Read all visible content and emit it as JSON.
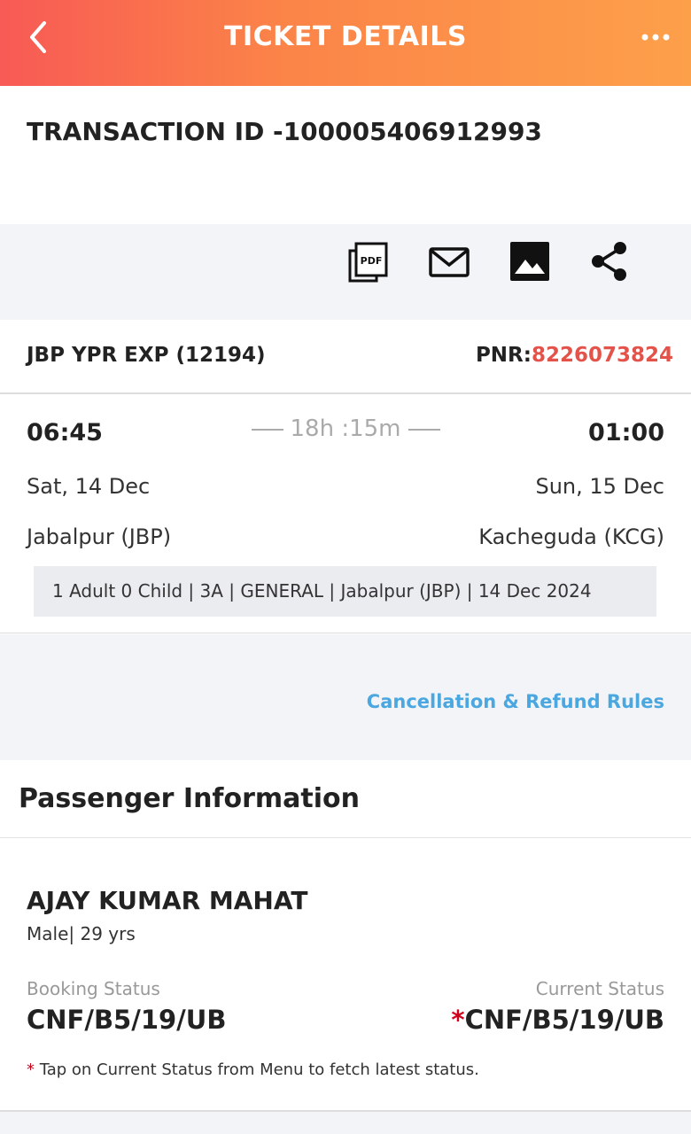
{
  "header": {
    "title": "TICKET DETAILS",
    "back_icon": "chevron-left-icon",
    "more_icon": "more-dots-icon"
  },
  "transaction": {
    "label": "TRANSACTION ID -100005406912993"
  },
  "actions": [
    {
      "icon": "pdf-icon"
    },
    {
      "icon": "mail-icon"
    },
    {
      "icon": "image-icon"
    },
    {
      "icon": "share-icon"
    }
  ],
  "train": {
    "name": "JBP YPR EXP  (12194)",
    "pnr_label": "PNR:",
    "pnr_value": "8226073824"
  },
  "journey": {
    "departure_time": "06:45",
    "arrival_time": "01:00",
    "duration": "18h :15m",
    "departure_date": "Sat, 14 Dec",
    "arrival_date": "Sun, 15 Dec",
    "departure_station": "Jabalpur (JBP)",
    "arrival_station": "Kacheguda (KCG)",
    "summary": "1 Adult 0 Child  | 3A | GENERAL | Jabalpur (JBP) | 14 Dec 2024"
  },
  "rules": {
    "link_label": "Cancellation & Refund Rules"
  },
  "passenger_section": {
    "title": "Passenger Information"
  },
  "passenger": {
    "name": "AJAY KUMAR MAHAT",
    "meta": "Male| 29 yrs",
    "booking_status_label": "Booking Status",
    "booking_status": "CNF/B5/19/UB",
    "current_status_label": "Current Status",
    "current_status_star": "*",
    "current_status": "CNF/B5/19/UB",
    "note_star": "*",
    "note": " Tap on Current Status from Menu to fetch latest status."
  },
  "colors": {
    "header_gradient_start": "#f85a55",
    "header_gradient_end": "#fda04a",
    "pnr": "#e4534a",
    "link": "#4aa7e0",
    "status_star": "#d0021b"
  }
}
